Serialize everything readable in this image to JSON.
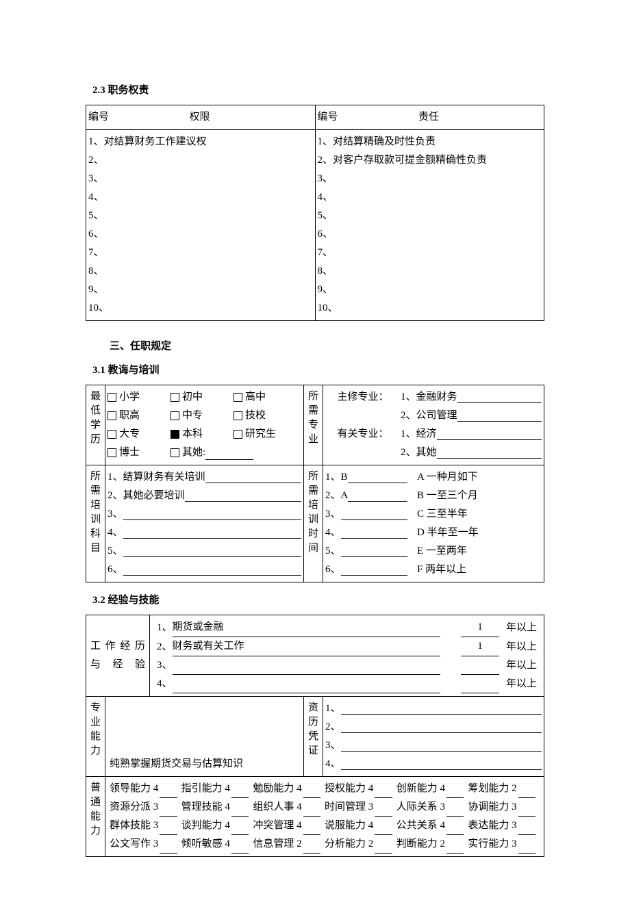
{
  "s23": {
    "title": "2.3  职务权责",
    "h_left_no": "编号",
    "h_left_lbl": "权限",
    "h_right_no": "编号",
    "h_right_lbl": "责任",
    "left": [
      "1、对结算财务工作建议权",
      "2、",
      "3、",
      "4、",
      "5、",
      "6、",
      "7、",
      "8、",
      "9、",
      "10、"
    ],
    "right": [
      "1、对结算精确及时性负责",
      "2、对客户存取款可提金额精确性负责",
      "3、",
      "4、",
      "5、",
      "6、",
      "7、",
      "8、",
      "9、",
      "10、"
    ]
  },
  "s3": {
    "title": "三、任职规定"
  },
  "s31": {
    "title": "3.1  教诲与培训",
    "edu_label": "最低学历",
    "edu": [
      [
        {
          "t": "小学",
          "c": 0
        },
        {
          "t": "初中",
          "c": 0
        },
        {
          "t": "高中",
          "c": 0
        }
      ],
      [
        {
          "t": "职高",
          "c": 0
        },
        {
          "t": "中专",
          "c": 0
        },
        {
          "t": "技校",
          "c": 0
        }
      ],
      [
        {
          "t": "大专",
          "c": 0
        },
        {
          "t": "本科",
          "c": 1
        },
        {
          "t": "研究生",
          "c": 0
        }
      ],
      [
        {
          "t": "博士",
          "c": 0
        },
        {
          "t": "其她:",
          "c": 0,
          "line": 1
        }
      ]
    ],
    "major_label": "所需专业",
    "major_main": "主修专业：",
    "major_rel": "有关专业：",
    "major_main_items": [
      "1、金融财务",
      "2、公司管理"
    ],
    "major_rel_items": [
      "1、经济",
      "2、其她"
    ],
    "train_sub_label": "所需培训科目",
    "train_sub": [
      "1、结算财务有关培训",
      "2、其她必要培训",
      "3、",
      "4、",
      "5、",
      "6、"
    ],
    "train_time_label": "所需培训时间",
    "train_time_items": [
      "1、B",
      "2、A",
      "3、",
      "4、",
      "5、",
      "6、"
    ],
    "train_time_opts": [
      "A 一种月如下",
      "B 一至三个月",
      "C 三至半年",
      "D 半年至一年",
      "E 一至两年",
      "F 两年以上"
    ]
  },
  "s32": {
    "title": "3.2  经验与技能",
    "exp_label": "工作经历与 经 验",
    "exp_items": [
      {
        "n": "1、",
        "t": "期货或金融",
        "y": "1"
      },
      {
        "n": "2、",
        "t": "财务或有关工作",
        "y": "1"
      },
      {
        "n": "3、",
        "t": "",
        "y": ""
      },
      {
        "n": "4、",
        "t": "",
        "y": ""
      }
    ],
    "exp_suffix": "年以上",
    "pro_label": "专业能力",
    "pro_text": "纯熟掌握期货交易与估算知识",
    "cert_label": "资历凭证",
    "cert_items": [
      "1、",
      "2、",
      "3、",
      "4、"
    ],
    "gen_label": "普通能力",
    "gen": [
      [
        "领导能力 4",
        "指引能力 4",
        "勉励能力 4",
        "授权能力 4",
        "创新能力 4",
        "筹划能力 2"
      ],
      [
        "资源分派 3",
        "管理技能 4",
        "组织人事 4",
        "时间管理 3",
        "人际关系 3",
        "协调能力 3"
      ],
      [
        "群体技能 3",
        "谈判能力 4",
        "冲突管理 4",
        "说服能力 4",
        "公共关系 4",
        "表达能力 3"
      ],
      [
        "公文写作 3",
        "倾听敏感 4",
        "信息管理 2",
        "分析能力 2",
        "判断能力 2",
        "实行能力 3"
      ]
    ]
  }
}
